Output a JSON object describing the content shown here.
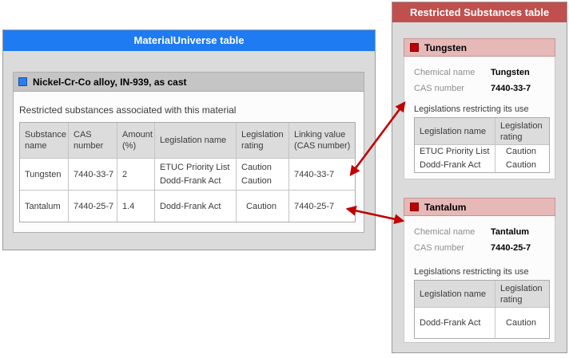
{
  "material_universe": {
    "title": "MaterialUniverse table",
    "record_title": "Nickel-Cr-Co alloy, IN-939, as cast",
    "section_label": "Restricted substances associated with this material",
    "table": {
      "headers": {
        "substance": "Substance name",
        "cas": "CAS number",
        "amount": "Amount (%)",
        "legislation": "Legislation name",
        "rating": "Legislation rating",
        "linking": "Linking value (CAS number)"
      },
      "rows": [
        {
          "substance": "Tungsten",
          "cas": "7440-33-7",
          "amount": "2",
          "legislation": [
            "ETUC Priority List",
            "Dodd-Frank Act"
          ],
          "rating": [
            "Caution",
            "Caution"
          ],
          "linking": "7440-33-7"
        },
        {
          "substance": "Tantalum",
          "cas": "7440-25-7",
          "amount": "1.4",
          "legislation": [
            "Dodd-Frank Act"
          ],
          "rating": [
            "Caution"
          ],
          "linking": "7440-25-7"
        }
      ]
    }
  },
  "restricted_substances": {
    "title": "Restricted Substances table",
    "cards": [
      {
        "name": "Tungsten",
        "chemical_name_label": "Chemical name",
        "chemical_name": "Tungsten",
        "cas_label": "CAS number",
        "cas": "7440-33-7",
        "section_label": "Legislations restricting its use",
        "table": {
          "name_header": "Legislation name",
          "rating_header": "Legislation rating",
          "names": [
            "ETUC Priority List",
            "Dodd-Frank Act"
          ],
          "ratings": [
            "Caution",
            "Caution"
          ]
        }
      },
      {
        "name": "Tantalum",
        "chemical_name_label": "Chemical name",
        "chemical_name": "Tantalum",
        "cas_label": "CAS number",
        "cas": "7440-25-7",
        "section_label": "Legislations restricting its use",
        "table": {
          "name_header": "Legislation name",
          "rating_header": "Legislation rating",
          "names": [
            "Dodd-Frank Act"
          ],
          "ratings": [
            "Caution"
          ]
        }
      }
    ]
  },
  "links": [
    {
      "from": "7440-33-7",
      "to": "Tungsten card"
    },
    {
      "from": "7440-25-7",
      "to": "Tantalum card"
    }
  ],
  "colors": {
    "mu_header": "#1e7bf2",
    "rs_header": "#c0504d",
    "card_header": "#e6b9b8",
    "blue_square": "#2b7cf0",
    "red_square": "#c00000",
    "arrow": "#c00000",
    "panel_bg": "#dbdbdb"
  }
}
